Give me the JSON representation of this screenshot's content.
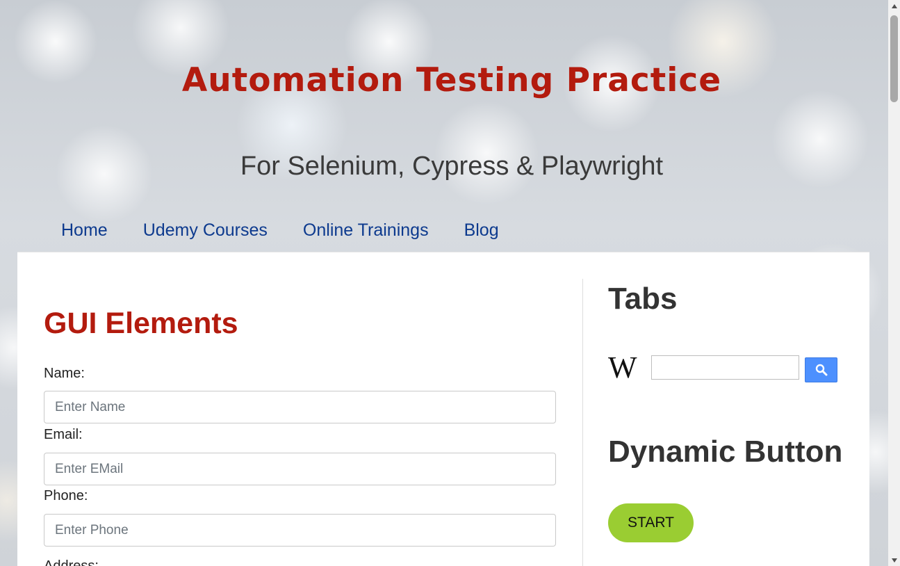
{
  "header": {
    "title": "Automation Testing Practice",
    "tagline": "For Selenium, Cypress & Playwright"
  },
  "nav": {
    "items": [
      {
        "label": "Home"
      },
      {
        "label": "Udemy Courses"
      },
      {
        "label": "Online Trainings"
      },
      {
        "label": "Blog"
      }
    ]
  },
  "main": {
    "title": "GUI Elements",
    "fields": [
      {
        "label": "Name:",
        "placeholder": "Enter Name",
        "value": ""
      },
      {
        "label": "Email:",
        "placeholder": "Enter EMail",
        "value": ""
      },
      {
        "label": "Phone:",
        "placeholder": "Enter Phone",
        "value": ""
      }
    ],
    "next_label": "Address:"
  },
  "sidebar": {
    "tabs_title": "Tabs",
    "wiki_logo": "W",
    "wiki_search_value": "",
    "search_icon": "search-icon",
    "dynamic_title": "Dynamic Button",
    "start_label": "START"
  },
  "colors": {
    "title_red": "#b31b0e",
    "nav_blue": "#0d3a8e",
    "start_green": "#9acd32",
    "search_blue": "#4d90fe"
  }
}
